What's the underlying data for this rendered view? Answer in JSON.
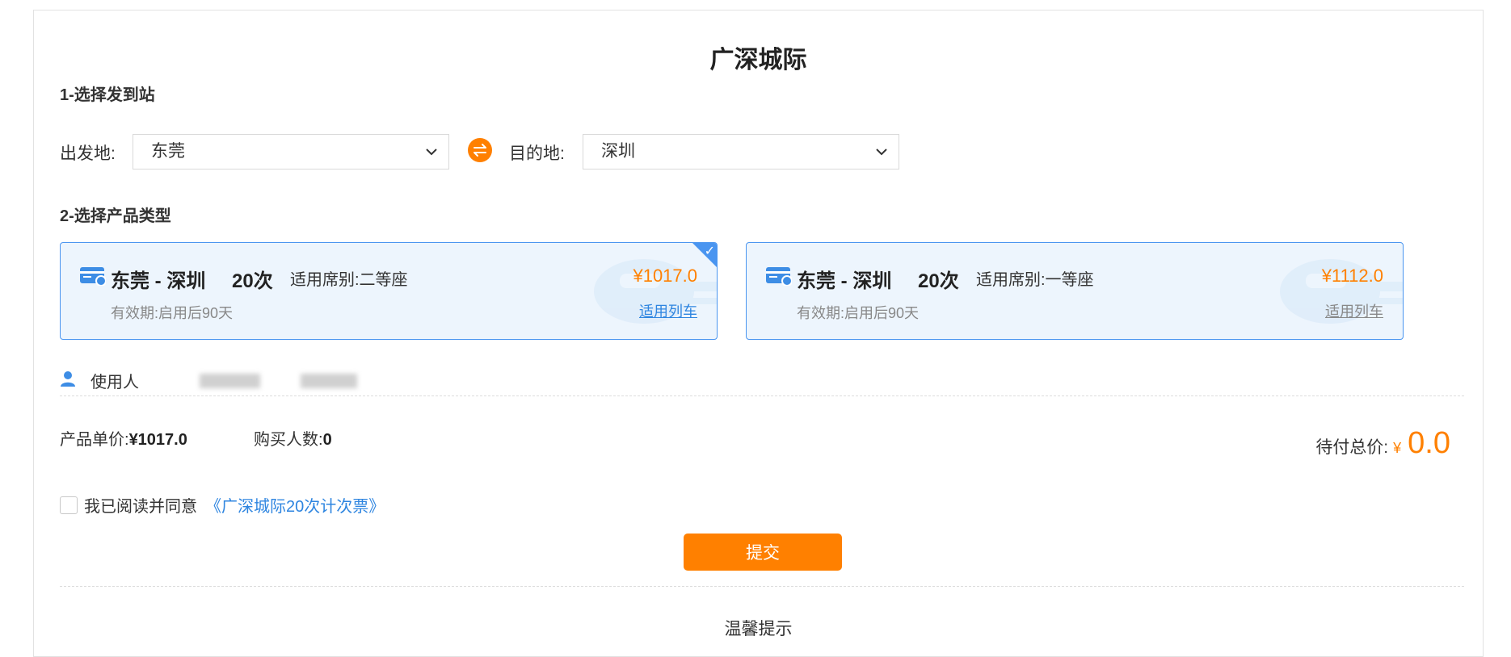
{
  "page": {
    "title": "广深城际"
  },
  "step1": {
    "label": "1-选择发到站",
    "from_label": "出发地:",
    "from_value": "东莞",
    "to_label": "目的地:",
    "to_value": "深圳"
  },
  "step2": {
    "label": "2-选择产品类型",
    "products": [
      {
        "route": "东莞 - 深圳",
        "count": "20次",
        "seat": "适用席别:二等座",
        "validity": "有效期:启用后90天",
        "price": "¥1017.0",
        "link": "适用列车",
        "selected": true
      },
      {
        "route": "东莞 - 深圳",
        "count": "20次",
        "seat": "适用席别:一等座",
        "validity": "有效期:启用后90天",
        "price": "¥1112.0",
        "link": "适用列车",
        "selected": false
      }
    ]
  },
  "user": {
    "label": "使用人"
  },
  "summary": {
    "unit_price_label": "产品单价:",
    "unit_price": "¥1017.0",
    "buyers_label": "购买人数:",
    "buyers": "0",
    "total_label": "待付总价:",
    "currency": "¥",
    "total": "0.0"
  },
  "agreement": {
    "text": "我已阅读并同意",
    "link": "《广深城际20次计次票》"
  },
  "submit_label": "提交",
  "tips_title": "温馨提示",
  "colors": {
    "accent": "#ff8000",
    "selected_border": "#4a95f0",
    "card_bg": "#edf5fd",
    "link": "#2e85e0"
  }
}
